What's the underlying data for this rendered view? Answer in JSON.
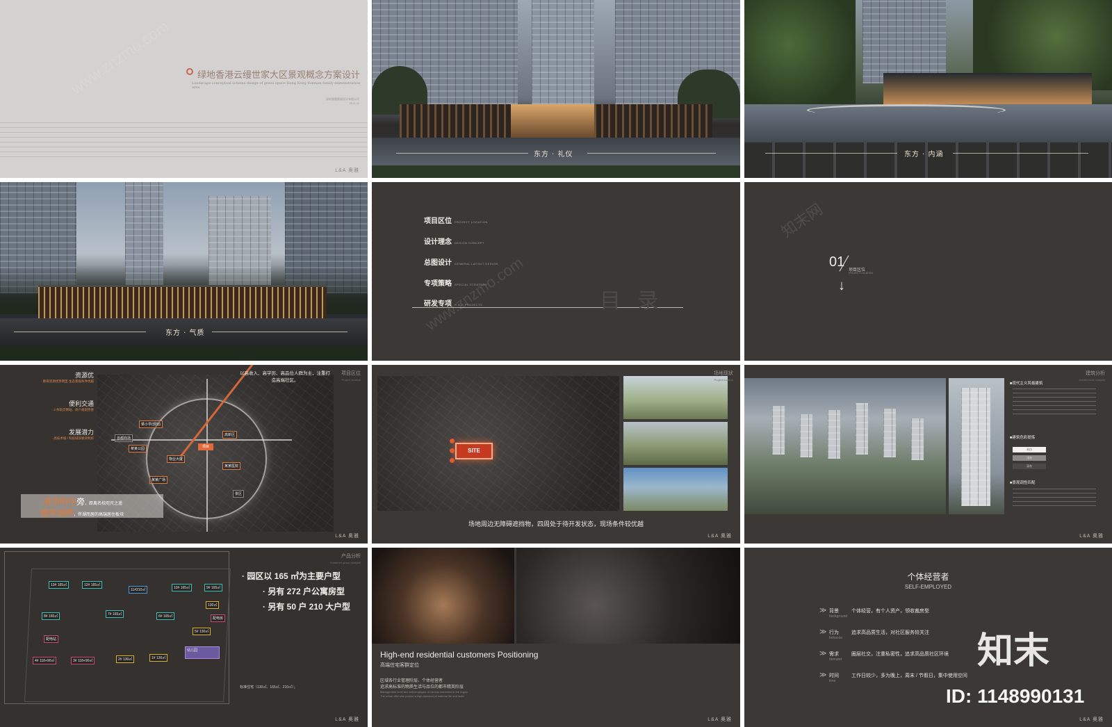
{
  "cover": {
    "title": "绿地香港云缦世家大区景观概念方案设计",
    "subtitle": "Landscape conceptual scheme design of green space Hong Kong Yunman family demonstration area",
    "company": "深圳奥雅景观设计有限公司",
    "year": "2021.11",
    "logo": "L&A 奥雅"
  },
  "photos": {
    "p1_caption": "东方 · 礼仪",
    "p2_caption": "东方 · 内涵",
    "p3_caption": "东方 · 气质"
  },
  "menu": {
    "items": [
      {
        "cn": "项目区位",
        "en": "PROJECT LOCATION"
      },
      {
        "cn": "设计理念",
        "en": "DESIGN CONCEPT"
      },
      {
        "cn": "总图设计",
        "en": "GENERAL LAYOUT DESIGN"
      },
      {
        "cn": "专项策略",
        "en": "SPECIAL STRATEGY"
      },
      {
        "cn": "研发专项",
        "en": "R & D PROJECTS"
      }
    ],
    "watermark": "目 录"
  },
  "section": {
    "number": "01",
    "cn": "项目区位",
    "en": "PROJECT LOCATION",
    "arrow": "↓"
  },
  "location": {
    "corner_cn": "项目区位",
    "corner_en": "Project location",
    "left_labels": [
      {
        "title": "资源优",
        "sub": "· 教育资源优势明显 生态景观条件优越"
      },
      {
        "title": "便利交通",
        "sub": "· 3 条轨交网站、商户规划完善"
      },
      {
        "title": "发展潜力",
        "sub": "· 高技术城 / 科技城双板块利好"
      }
    ],
    "top_note": "以高收入、高学历、高品位人群为主，注重打造高端社区。",
    "site_label": "项目",
    "banner1_hl": "清华附中",
    "banner1_a": "旁",
    "banner1_b": "，距离名校咫尺之遥",
    "banner2_hl": "檀李湖畔",
    "banner2_b": "，伴湖而居的高端居住板块",
    "pois": [
      "菜小学(规划)",
      "物业大厦",
      "高新区",
      "菜某公园",
      "某某医院",
      "某某广场",
      "首都商场",
      "景区"
    ]
  },
  "site": {
    "corner_cn": "场地现状",
    "corner_en": "Project location",
    "site_tag": "SITE",
    "caption": "场地周边无障碍遮挡物，四周处于待开发状态，现场条件较优越"
  },
  "arch": {
    "corner_cn": "建筑分析",
    "corner_en": "Architectural analysis",
    "headings": [
      "■现代主义风格建筑",
      "■建筑色彩提炼",
      "■景观调性匹配"
    ],
    "swatch_labels": [
      "米白",
      "浅灰",
      "深灰"
    ]
  },
  "product": {
    "corner_cn": "产品分析",
    "corner_en": "Customer group analysis",
    "bullets": [
      "· 园区以 165 ㎡为主要户型",
      "· 另有 272 户公寓房型",
      "· 另有 50 户 210 大户型"
    ],
    "units": [
      "13# 165㎡",
      "12# 165㎡",
      "11#210㎡",
      "10# 165㎡",
      "9# 165㎡",
      "8# 165㎡",
      "7# 165㎡",
      "6# 165㎡",
      "5# 130㎡",
      "130㎡",
      "配电房",
      "4# 118+90㎡",
      "3# 118+90㎡",
      "2# 130㎡",
      "1# 130㎡",
      "幼儿园",
      "配电站"
    ],
    "note": "标准住宅（130㎡、165㎡、210㎡）；"
  },
  "customers": {
    "title": "High-end residential customers Positioning",
    "subtitle": "高端住宅客群定位",
    "line1": "区域各行业管理阶层、个体经营者",
    "line2": "追求高标准的物质生活与品位的都市精英阶层",
    "line3": "Management level and self-employed of various industries in the region",
    "line4": "The urban elite who pursue a high standard of material life and taste"
  },
  "persona": {
    "title": "个体经营者",
    "subtitle": "SELF-EMPLOYED",
    "rows": [
      {
        "k": "背景",
        "ke": "background",
        "v": "个体经营，有个人资产，领收裁房型"
      },
      {
        "k": "行为",
        "ke": "behavior",
        "v": "追求高品质生活，对社区服务较关注"
      },
      {
        "k": "需求",
        "ke": "demand",
        "v": "圈层社交，注重私密性，追求高品质社区环境"
      },
      {
        "k": "时间",
        "ke": "time",
        "v": "工作日较少，多为晚上，周末 / 节假日，集中使用空间"
      }
    ],
    "arrow": "≫"
  },
  "watermarks": {
    "site_url": "www.znzmo.com",
    "cn_brand": "知末网",
    "brand_big": "知末",
    "id_label": "ID: 1148990131"
  }
}
